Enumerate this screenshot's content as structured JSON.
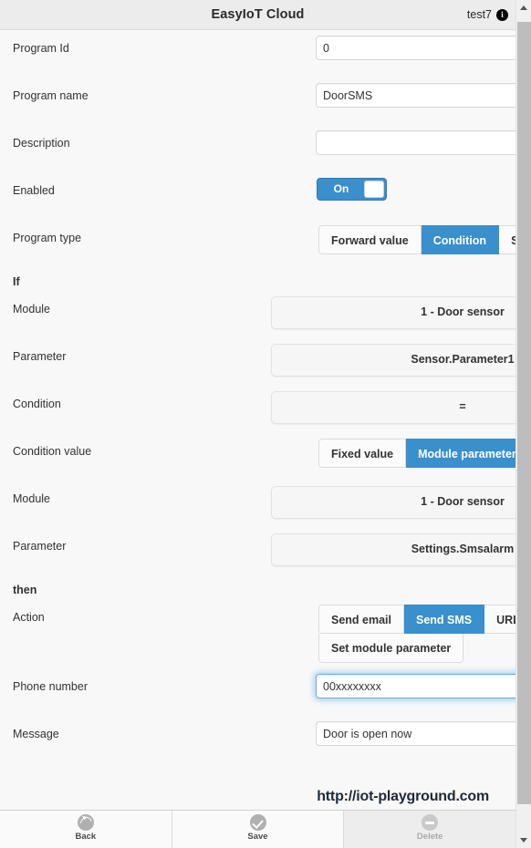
{
  "header": {
    "title": "EasyIoT Cloud",
    "user": "test7",
    "info_icon": "info-icon"
  },
  "form": {
    "program_id": {
      "label": "Program Id",
      "value": "0"
    },
    "program_name": {
      "label": "Program name",
      "value": "DoorSMS"
    },
    "description": {
      "label": "Description",
      "value": ""
    },
    "enabled": {
      "label": "Enabled",
      "state": "On"
    },
    "program_type": {
      "label": "Program type",
      "options": [
        "Forward value",
        "Condition",
        "Schedule"
      ],
      "selected": "Condition"
    },
    "if_label": "If",
    "if_module": {
      "label": "Module",
      "value": "1 - Door sensor"
    },
    "if_parameter": {
      "label": "Parameter",
      "value": "Sensor.Parameter1"
    },
    "if_condition": {
      "label": "Condition",
      "value": "="
    },
    "condition_value": {
      "label": "Condition value",
      "options": [
        "Fixed value",
        "Module parameter"
      ],
      "selected": "Module parameter"
    },
    "cv_module": {
      "label": "Module",
      "value": "1 - Door sensor"
    },
    "cv_parameter": {
      "label": "Parameter",
      "value": "Settings.Smsalarm"
    },
    "then_label": "then",
    "action": {
      "label": "Action",
      "options": [
        "Send email",
        "Send SMS",
        "URL request",
        "Set module parameter"
      ],
      "selected": "Send SMS"
    },
    "phone_number": {
      "label": "Phone number",
      "value": "00xxxxxxxx",
      "focused": true
    },
    "message": {
      "label": "Message",
      "value": "Door is open now"
    }
  },
  "toolbar": {
    "back": {
      "label": "Back",
      "icon": "undo-icon"
    },
    "save": {
      "label": "Save",
      "icon": "check-circle-icon"
    },
    "delete": {
      "label": "Delete",
      "icon": "minus-circle-icon"
    }
  },
  "watermark": "http://iot-playground.com",
  "colors": {
    "accent": "#3a8fcd",
    "header_bg": "#ececec",
    "page_bg": "#f8f8f8",
    "focus_glow": "#66afe9"
  }
}
